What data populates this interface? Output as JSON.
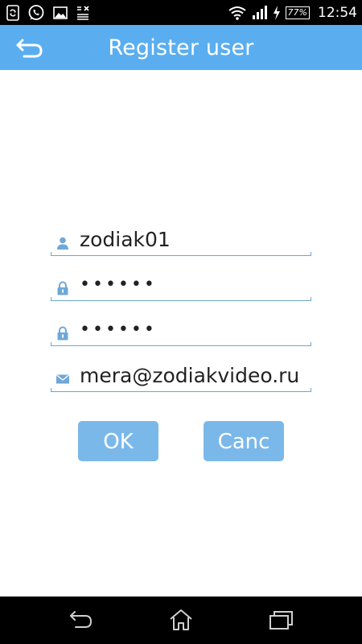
{
  "status_bar": {
    "battery": "77%",
    "time": "12:54",
    "icons": [
      "sync-icon",
      "whatsapp-icon",
      "gallery-icon",
      "notes-icon",
      "wifi-icon",
      "signal-icon",
      "charging-icon",
      "battery-icon"
    ]
  },
  "header": {
    "title": "Register user",
    "back_icon": "back-arrow-icon",
    "background": "#5aaef0"
  },
  "form": {
    "username": {
      "value": "zodiak01",
      "icon": "user-icon"
    },
    "password": {
      "value": "••••••",
      "icon": "lock-icon"
    },
    "confirm_password": {
      "value": "••••••",
      "icon": "lock-icon"
    },
    "email": {
      "value": "mera@zodiakvideo.ru",
      "icon": "mail-icon"
    },
    "underline_color": "#6aa7cc"
  },
  "buttons": {
    "ok": "OK",
    "cancel": "Canc",
    "color": "#7bb8ea"
  },
  "nav_bar": {
    "icons": [
      "nav-back-icon",
      "nav-home-icon",
      "nav-recent-icon"
    ]
  }
}
